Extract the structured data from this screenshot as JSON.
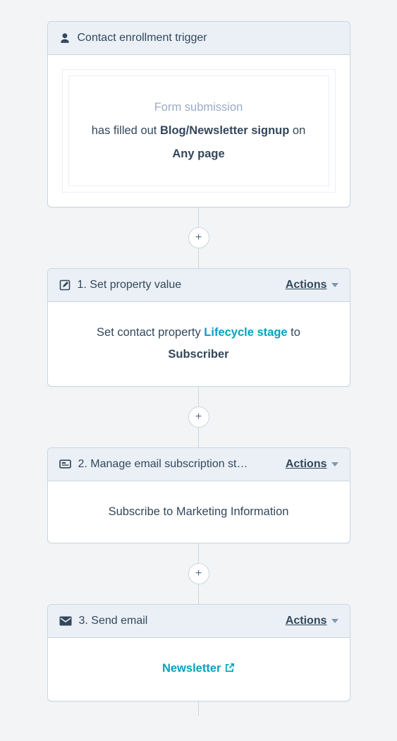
{
  "trigger": {
    "title": "Contact enrollment trigger",
    "label": "Form submission",
    "prefix": "has filled out ",
    "form_name": "Blog/Newsletter signup",
    "mid": " on ",
    "page": "Any page"
  },
  "actions_label": "Actions",
  "plus_label": "+",
  "step1": {
    "title": "1. Set property value",
    "body_prefix": "Set contact property ",
    "property": "Lifecycle stage",
    "body_mid": " to ",
    "value": "Subscriber"
  },
  "step2": {
    "title": "2. Manage email subscription st…",
    "body": "Subscribe to Marketing Information"
  },
  "step3": {
    "title": "3. Send email",
    "link": "Newsletter"
  }
}
